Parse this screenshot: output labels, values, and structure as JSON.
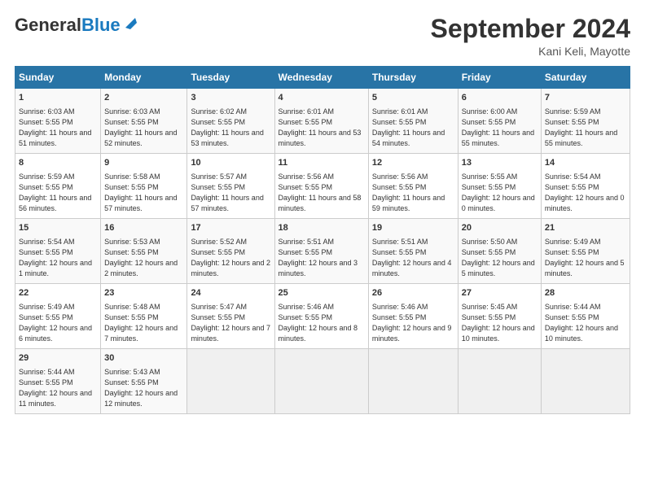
{
  "header": {
    "logo_general": "General",
    "logo_blue": "Blue",
    "month_title": "September 2024",
    "location": "Kani Keli, Mayotte"
  },
  "days_of_week": [
    "Sunday",
    "Monday",
    "Tuesday",
    "Wednesday",
    "Thursday",
    "Friday",
    "Saturday"
  ],
  "weeks": [
    [
      {
        "day": "1",
        "sunrise": "6:03 AM",
        "sunset": "5:55 PM",
        "daylight": "11 hours and 51 minutes."
      },
      {
        "day": "2",
        "sunrise": "6:03 AM",
        "sunset": "5:55 PM",
        "daylight": "11 hours and 52 minutes."
      },
      {
        "day": "3",
        "sunrise": "6:02 AM",
        "sunset": "5:55 PM",
        "daylight": "11 hours and 53 minutes."
      },
      {
        "day": "4",
        "sunrise": "6:01 AM",
        "sunset": "5:55 PM",
        "daylight": "11 hours and 53 minutes."
      },
      {
        "day": "5",
        "sunrise": "6:01 AM",
        "sunset": "5:55 PM",
        "daylight": "11 hours and 54 minutes."
      },
      {
        "day": "6",
        "sunrise": "6:00 AM",
        "sunset": "5:55 PM",
        "daylight": "11 hours and 55 minutes."
      },
      {
        "day": "7",
        "sunrise": "5:59 AM",
        "sunset": "5:55 PM",
        "daylight": "11 hours and 55 minutes."
      }
    ],
    [
      {
        "day": "8",
        "sunrise": "5:59 AM",
        "sunset": "5:55 PM",
        "daylight": "11 hours and 56 minutes."
      },
      {
        "day": "9",
        "sunrise": "5:58 AM",
        "sunset": "5:55 PM",
        "daylight": "11 hours and 57 minutes."
      },
      {
        "day": "10",
        "sunrise": "5:57 AM",
        "sunset": "5:55 PM",
        "daylight": "11 hours and 57 minutes."
      },
      {
        "day": "11",
        "sunrise": "5:56 AM",
        "sunset": "5:55 PM",
        "daylight": "11 hours and 58 minutes."
      },
      {
        "day": "12",
        "sunrise": "5:56 AM",
        "sunset": "5:55 PM",
        "daylight": "11 hours and 59 minutes."
      },
      {
        "day": "13",
        "sunrise": "5:55 AM",
        "sunset": "5:55 PM",
        "daylight": "12 hours and 0 minutes."
      },
      {
        "day": "14",
        "sunrise": "5:54 AM",
        "sunset": "5:55 PM",
        "daylight": "12 hours and 0 minutes."
      }
    ],
    [
      {
        "day": "15",
        "sunrise": "5:54 AM",
        "sunset": "5:55 PM",
        "daylight": "12 hours and 1 minute."
      },
      {
        "day": "16",
        "sunrise": "5:53 AM",
        "sunset": "5:55 PM",
        "daylight": "12 hours and 2 minutes."
      },
      {
        "day": "17",
        "sunrise": "5:52 AM",
        "sunset": "5:55 PM",
        "daylight": "12 hours and 2 minutes."
      },
      {
        "day": "18",
        "sunrise": "5:51 AM",
        "sunset": "5:55 PM",
        "daylight": "12 hours and 3 minutes."
      },
      {
        "day": "19",
        "sunrise": "5:51 AM",
        "sunset": "5:55 PM",
        "daylight": "12 hours and 4 minutes."
      },
      {
        "day": "20",
        "sunrise": "5:50 AM",
        "sunset": "5:55 PM",
        "daylight": "12 hours and 5 minutes."
      },
      {
        "day": "21",
        "sunrise": "5:49 AM",
        "sunset": "5:55 PM",
        "daylight": "12 hours and 5 minutes."
      }
    ],
    [
      {
        "day": "22",
        "sunrise": "5:49 AM",
        "sunset": "5:55 PM",
        "daylight": "12 hours and 6 minutes."
      },
      {
        "day": "23",
        "sunrise": "5:48 AM",
        "sunset": "5:55 PM",
        "daylight": "12 hours and 7 minutes."
      },
      {
        "day": "24",
        "sunrise": "5:47 AM",
        "sunset": "5:55 PM",
        "daylight": "12 hours and 7 minutes."
      },
      {
        "day": "25",
        "sunrise": "5:46 AM",
        "sunset": "5:55 PM",
        "daylight": "12 hours and 8 minutes."
      },
      {
        "day": "26",
        "sunrise": "5:46 AM",
        "sunset": "5:55 PM",
        "daylight": "12 hours and 9 minutes."
      },
      {
        "day": "27",
        "sunrise": "5:45 AM",
        "sunset": "5:55 PM",
        "daylight": "12 hours and 10 minutes."
      },
      {
        "day": "28",
        "sunrise": "5:44 AM",
        "sunset": "5:55 PM",
        "daylight": "12 hours and 10 minutes."
      }
    ],
    [
      {
        "day": "29",
        "sunrise": "5:44 AM",
        "sunset": "5:55 PM",
        "daylight": "12 hours and 11 minutes."
      },
      {
        "day": "30",
        "sunrise": "5:43 AM",
        "sunset": "5:55 PM",
        "daylight": "12 hours and 12 minutes."
      },
      null,
      null,
      null,
      null,
      null
    ]
  ]
}
